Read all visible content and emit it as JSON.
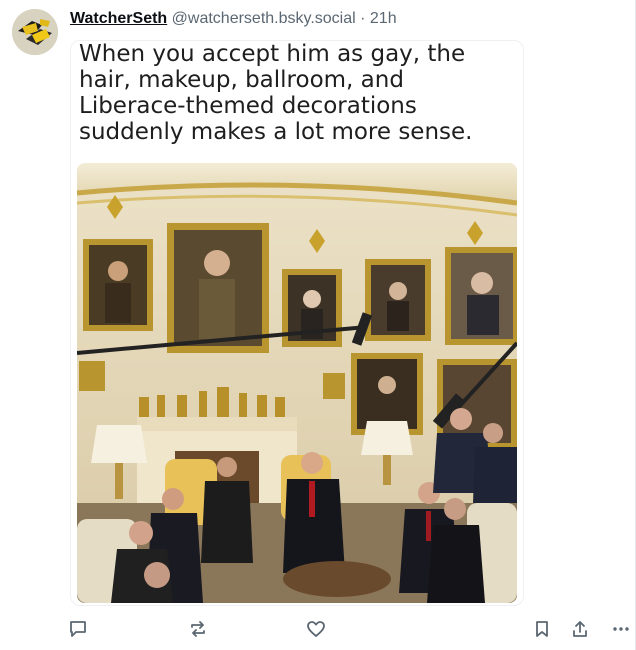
{
  "post": {
    "author": {
      "display_name": "WatcherSeth",
      "handle": "@watcherseth.bsky.social",
      "avatar_icon": "avatar-image"
    },
    "separator": "·",
    "timestamp": "21h",
    "image": {
      "caption_text": "When you accept him as gay, the\nhair, makeup, ballroom, and\nLiberace-themed decorations\nsuddenly makes a lot more sense.",
      "photo_icon": "oval-office-photo"
    },
    "actions": {
      "reply_icon": "reply-icon",
      "repost_icon": "repost-icon",
      "like_icon": "heart-icon",
      "bookmark_icon": "bookmark-icon",
      "share_icon": "share-icon",
      "more_icon": "more-options-icon"
    },
    "colors": {
      "icon": "#5b6772",
      "text": "#0b0f14",
      "muted": "#5b6772"
    }
  }
}
